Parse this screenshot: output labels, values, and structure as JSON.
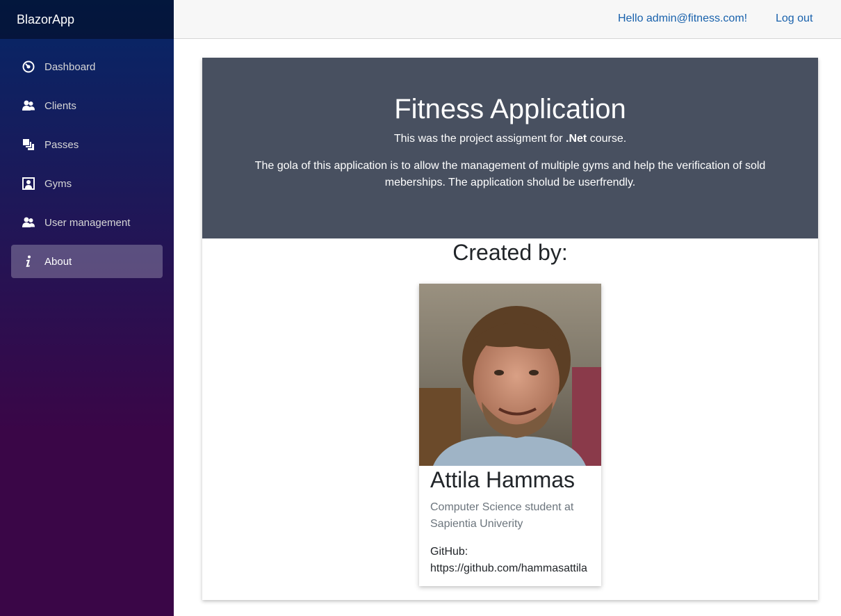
{
  "brand": "BlazorApp",
  "nav": {
    "items": [
      {
        "label": "Dashboard",
        "icon": "dashboard-icon"
      },
      {
        "label": "Clients",
        "icon": "people-icon"
      },
      {
        "label": "Passes",
        "icon": "layers-icon"
      },
      {
        "label": "Gyms",
        "icon": "location-icon"
      },
      {
        "label": "User management",
        "icon": "people-icon"
      },
      {
        "label": "About",
        "icon": "info-icon",
        "active": true
      }
    ]
  },
  "topbar": {
    "hello": "Hello admin@fitness.com!",
    "logout": "Log out"
  },
  "hero": {
    "title": "Fitness Application",
    "line1_pre": "This was the project assigment for ",
    "line1_bold": ".Net",
    "line1_post": " course.",
    "line2": "The gola of this application is to allow the management of multiple gyms and help the verification of sold meberships. The application sholud be userfrendly."
  },
  "created_by": "Created by:",
  "person": {
    "name": "Attila Hammas",
    "subtitle": "Computer Science student at Sapientia Univerity",
    "github": "GitHub: https://github.com/hammasattila"
  },
  "colors": {
    "sidebar_top": "#052767",
    "sidebar_bottom": "#3a0647",
    "hero_bg": "#485060",
    "link": "#1861ac"
  }
}
